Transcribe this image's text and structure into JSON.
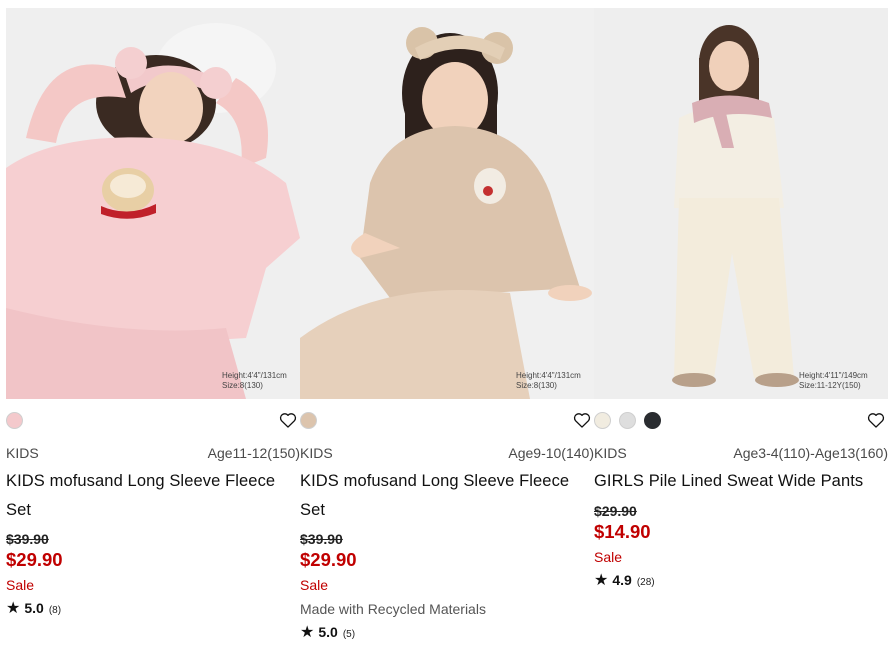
{
  "products": [
    {
      "image_caption_height": "Height:4'4\"/131cm",
      "image_caption_size": "Size:8(130)",
      "swatches": [
        "#f4c9cc"
      ],
      "category": "KIDS",
      "sizes": "Age11-12(150)",
      "name": "KIDS mofusand Long Sleeve Fleece Set",
      "old_price": "$39.90",
      "new_price": "$29.90",
      "sale_label": "Sale",
      "extra_label": "",
      "rating": "5.0",
      "review_count": "(8)"
    },
    {
      "image_caption_height": "Height:4'4\"/131cm",
      "image_caption_size": "Size:8(130)",
      "swatches": [
        "#dcc4ad"
      ],
      "category": "KIDS",
      "sizes": "Age9-10(140)",
      "name": "KIDS mofusand Long Sleeve Fleece Set",
      "old_price": "$39.90",
      "new_price": "$29.90",
      "sale_label": "Sale",
      "extra_label": "Made with Recycled Materials",
      "rating": "5.0",
      "review_count": "(5)"
    },
    {
      "image_caption_height": "Height:4'11\"/149cm",
      "image_caption_size": "Size:11-12Y(150)",
      "swatches": [
        "#f1ece0",
        "#dedede",
        "#2a2c30"
      ],
      "category": "KIDS",
      "sizes": "Age3-4(110)-Age13(160)",
      "name": "GIRLS Pile Lined Sweat Wide Pants",
      "old_price": "$29.90",
      "new_price": "$14.90",
      "sale_label": "Sale",
      "extra_label": "",
      "rating": "4.9",
      "review_count": "(28)"
    }
  ],
  "colors": {
    "sale_red": "#c00000",
    "text": "#1b1b1b"
  },
  "icons": {
    "favorite": "heart-outline-icon",
    "rating": "star-icon"
  }
}
